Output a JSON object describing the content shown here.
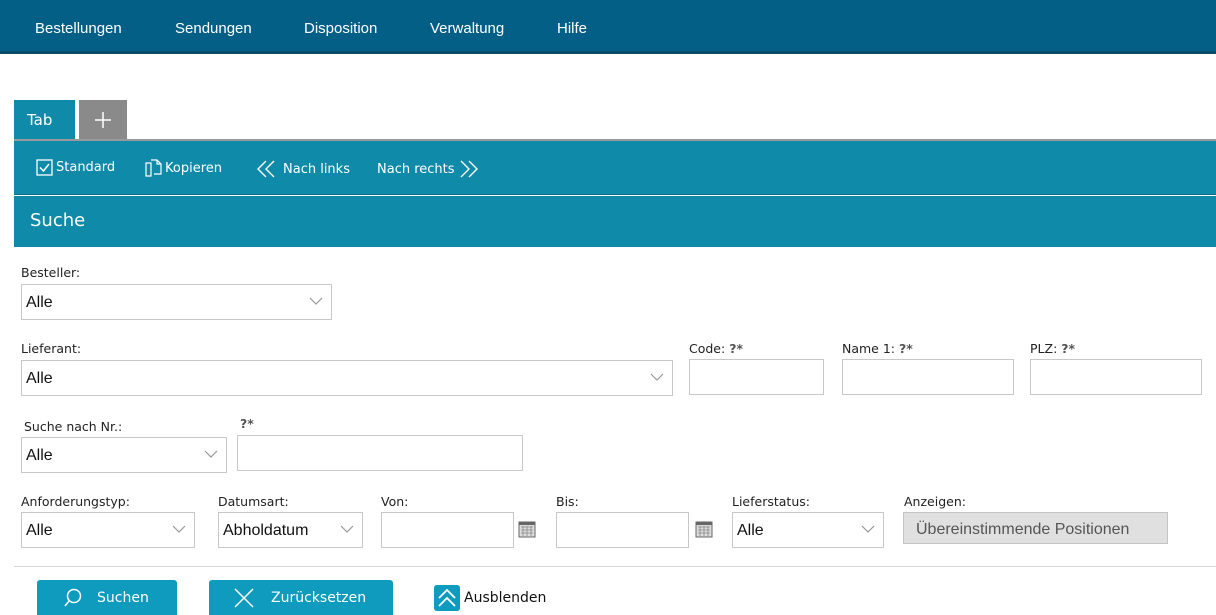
{
  "nav": [
    "Bestellungen",
    "Sendungen",
    "Disposition",
    "Verwaltung",
    "Hilfe"
  ],
  "tabs": {
    "active": "Tab",
    "add": "+"
  },
  "toolbar": {
    "standard": "Standard",
    "copy": "Kopieren",
    "left": "Nach links",
    "right": "Nach rechts"
  },
  "section": {
    "title": "Suche"
  },
  "form": {
    "besteller": {
      "label": "Besteller:",
      "value": "Alle"
    },
    "lieferant": {
      "label": "Lieferant:",
      "value": "Alle"
    },
    "code": {
      "label": "Code:",
      "hint": "?*"
    },
    "name1": {
      "label": "Name 1:",
      "hint": "?*"
    },
    "plz": {
      "label": "PLZ:",
      "hint": "?*"
    },
    "suche_nr": {
      "label": "Suche nach Nr.:",
      "value": "Alle"
    },
    "nr_hint": "?*",
    "anforderungstyp": {
      "label": "Anforderungstyp:",
      "value": "Alle"
    },
    "datumsart": {
      "label": "Datumsart:",
      "value": "Abholdatum"
    },
    "von": {
      "label": "Von:"
    },
    "bis": {
      "label": "Bis:"
    },
    "lieferstatus": {
      "label": "Lieferstatus:",
      "value": "Alle"
    },
    "anzeigen": {
      "label": "Anzeigen:",
      "value": "Übereinstimmende Positionen"
    }
  },
  "actions": {
    "search": "Suchen",
    "reset": "Zurücksetzen",
    "hide": "Ausblenden"
  },
  "colors": {
    "nav_bg": "#045f86",
    "teal": "#0f8aa8",
    "button": "#0f9bbd"
  }
}
